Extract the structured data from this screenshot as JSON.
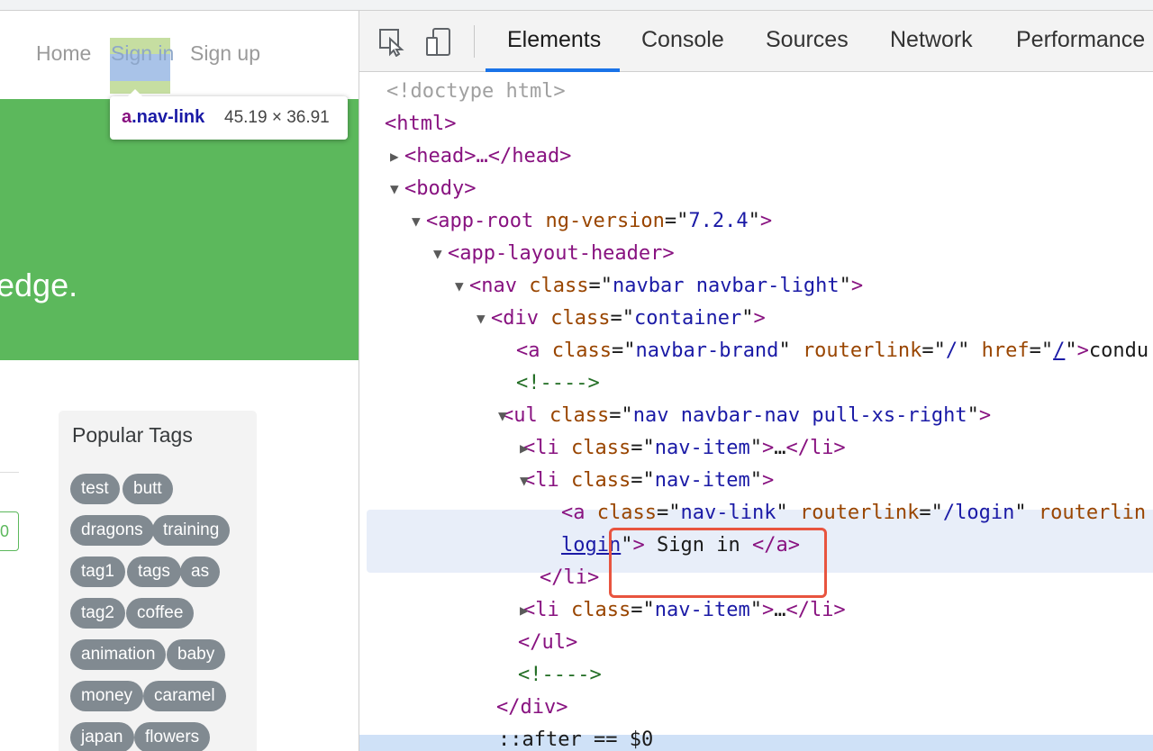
{
  "site": {
    "nav": {
      "home": "Home",
      "sign_in": "Sign in",
      "sign_up": "Sign up"
    },
    "inspect_tooltip": {
      "tag": "a",
      "class": ".nav-link",
      "dims": "45.19 × 36.91"
    },
    "banner_slogan": "edge.",
    "feed_button_text": "0",
    "sidebar": {
      "title": "Popular Tags",
      "tags": [
        "test",
        "butt",
        "dragons",
        "training",
        "tag1",
        "tags",
        "as",
        "tag2",
        "coffee",
        "animation",
        "baby",
        "money",
        "caramel",
        "japan",
        "flowers"
      ]
    }
  },
  "devtools": {
    "tabs": [
      "Elements",
      "Console",
      "Sources",
      "Network",
      "Performance"
    ],
    "active_tab": "Elements",
    "dom": {
      "doctype": "<!doctype html>",
      "html_open": "<html>",
      "head": "<head>…</head>",
      "body_open": "<body>",
      "app_root": {
        "tag": "app-root",
        "attr": "ng-version",
        "value": "7.2.4"
      },
      "layout_header": "<app-layout-header>",
      "nav": {
        "tag": "nav",
        "attr": "class",
        "value": "navbar navbar-light"
      },
      "container_div": {
        "tag": "div",
        "attr": "class",
        "value": "container"
      },
      "brand_link": {
        "class": "navbar-brand",
        "routerlink": "/",
        "href": "/",
        "text": "condu"
      },
      "comment": "<!---->",
      "ul": {
        "class": "nav navbar-nav pull-xs-right"
      },
      "li_class": "nav-item",
      "collapsed": "…",
      "selected_link": {
        "class": "nav-link",
        "routerlink": "/login",
        "attr_trail": "routerlin",
        "href_value_tail": "login",
        "text": " Sign in "
      },
      "li_close": "</li>",
      "ul_close": "</ul>",
      "div_close": "</div>",
      "after_pseudo": "::after == $0"
    }
  }
}
